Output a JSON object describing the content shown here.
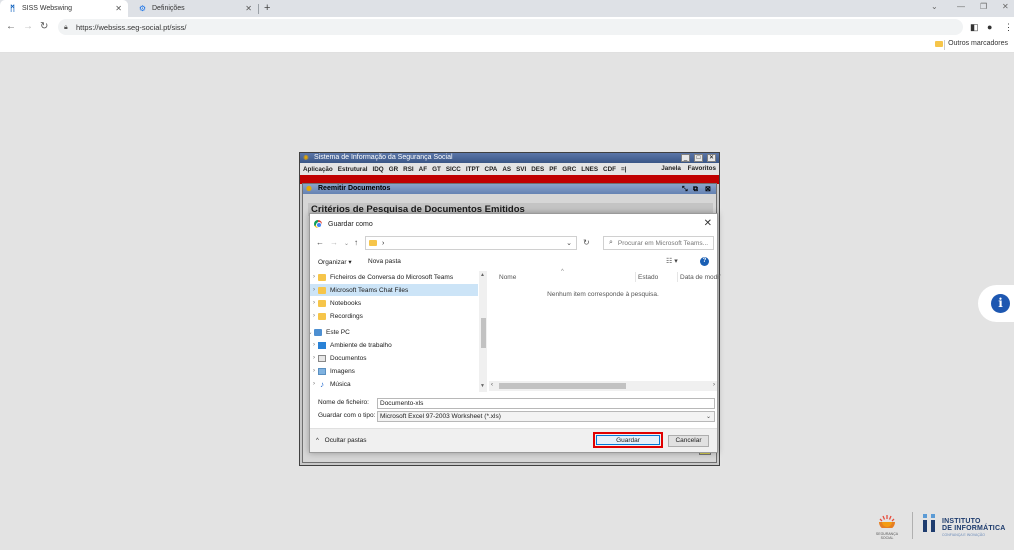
{
  "browser": {
    "tabs": [
      {
        "label": "SISS Webswing"
      },
      {
        "label": "Definições"
      }
    ],
    "url": "https://websiss.seg-social.pt/siss/",
    "bookmark_other": "Outros marcadores"
  },
  "app": {
    "title": "Sistema de Informação da Segurança Social",
    "menu": [
      "Aplicação",
      "Estrutural",
      "IDQ",
      "GR",
      "RSI",
      "AF",
      "GT",
      "SICC",
      "ITPT",
      "CPA",
      "AS",
      "SVI",
      "DES",
      "PF",
      "GRC",
      "LNES",
      "CDF",
      "=|"
    ],
    "menu_right": [
      "Janela",
      "Favoritos"
    ],
    "inner_title": "Reemitir Documentos",
    "criteria_title": "Critérios de Pesquisa de Documentos Emitidos"
  },
  "dialog": {
    "title": "Guardar como",
    "path": "›",
    "search_placeholder": "Procurar em Microsoft Teams...",
    "toolbar": {
      "organize": "Organizar ▾",
      "new_folder": "Nova pasta"
    },
    "tree": [
      {
        "label": "Ficheiros de Conversa do Microsoft Teams",
        "icon": "folder-icon",
        "chev": "›"
      },
      {
        "label": "Microsoft Teams Chat Files",
        "icon": "folder-icon",
        "chev": "›",
        "selected": true
      },
      {
        "label": "Notebooks",
        "icon": "folder-icon",
        "chev": "›"
      },
      {
        "label": "Recordings",
        "icon": "folder-icon",
        "chev": "›"
      },
      {
        "label": "Este PC",
        "icon": "pc-icon",
        "chev": "⌄"
      },
      {
        "label": "Ambiente de trabalho",
        "icon": "desktop-icon",
        "chev": "›"
      },
      {
        "label": "Documentos",
        "icon": "documents-icon",
        "chev": "›"
      },
      {
        "label": "Imagens",
        "icon": "images-icon",
        "chev": "›"
      },
      {
        "label": "Música",
        "icon": "music-icon",
        "chev": "›"
      }
    ],
    "columns": {
      "name": "Nome",
      "state": "Estado",
      "date": "Data de modif"
    },
    "empty_message": "Nenhum item corresponde à pesquisa.",
    "filename_label": "Nome de ficheiro:",
    "filename_value": "Documento-xls",
    "type_label": "Guardar com o tipo:",
    "type_value": "Microsoft Excel 97-2003 Worksheet (*.xls)",
    "hide_folders": "Ocultar pastas",
    "save_button": "Guardar",
    "cancel_button": "Cancelar"
  },
  "footer": {
    "ss_text": "SEGURANÇA SOCIAL",
    "ii_line1": "INSTITUTO",
    "ii_line2": "DE INFORMÁTICA",
    "ii_tagline": "CONFIANÇA E INOVAÇÃO"
  },
  "colors": {
    "highlight": "#e00000",
    "accent": "#1d57b1"
  }
}
